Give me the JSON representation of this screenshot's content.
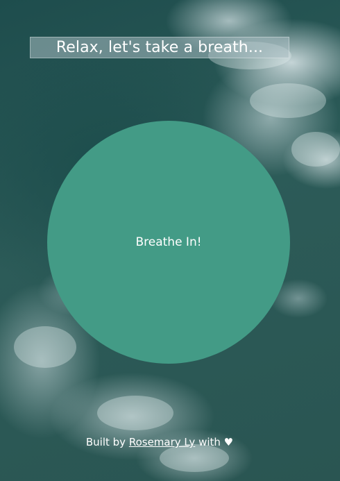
{
  "header": {
    "title": "Relax, let's take a breath..."
  },
  "breath_circle": {
    "label": "Breathe In!",
    "color": "#439b86"
  },
  "footer": {
    "prefix": "Built by",
    "author_link": "Rosemary Ly",
    "suffix": "with",
    "heart_icon": "heart-icon",
    "heart_glyph": "♥"
  }
}
